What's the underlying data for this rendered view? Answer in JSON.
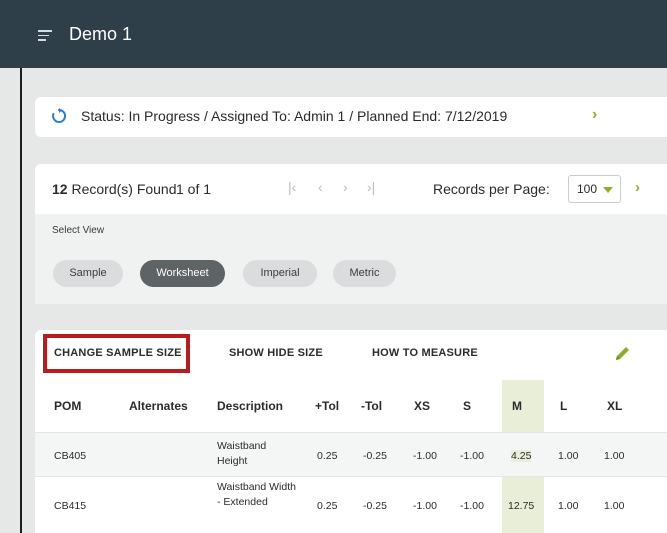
{
  "header": {
    "title": "Demo 1",
    "menu_icon": "menu-icon"
  },
  "status": {
    "icon": "sync-icon",
    "text": "Status: In Progress / Assigned To: Admin 1 / Planned End: 7/12/2019",
    "chevron": "›"
  },
  "pager": {
    "count": "12",
    "found_label": " Record(s) Found",
    "page": "1 of 1",
    "first": "|‹",
    "prev": "‹",
    "next_page": "›",
    "last": "›|",
    "records_per_page_label": "Records per Page:",
    "records_per_page": "100",
    "next": "›"
  },
  "view": {
    "label": "Select View",
    "options": [
      "Sample",
      "Worksheet",
      "Imperial",
      "Metric"
    ],
    "selected": "Worksheet"
  },
  "toolbar": {
    "change_sample_size": "CHANGE SAMPLE SIZE",
    "show_hide_size": "SHOW HIDE SIZE",
    "how_to_measure": "HOW TO MEASURE",
    "edit_icon": "pencil-icon"
  },
  "table": {
    "columns": [
      "POM",
      "Alternates",
      "Description",
      "+Tol",
      "-Tol",
      "XS",
      "S",
      "M",
      "L",
      "XL"
    ],
    "highlighted_column": "M",
    "rows": [
      {
        "pom": "CB405",
        "alternates": "",
        "description": "Waistband Height",
        "plus_tol": "0.25",
        "minus_tol": "-0.25",
        "xs": "-1.00",
        "s": "-1.00",
        "m": "4.25",
        "l": "1.00",
        "xl": "1.00"
      },
      {
        "pom": "CB415",
        "alternates": "",
        "description": "Waistband Width - Extended",
        "plus_tol": "0.25",
        "minus_tol": "-0.25",
        "xs": "-1.00",
        "s": "-1.00",
        "m": "12.75",
        "l": "1.00",
        "xl": "1.00"
      }
    ]
  },
  "colors": {
    "header_bg": "#2f3f4a",
    "accent_green": "#8fae2a",
    "highlight_red": "#b81c1c",
    "m_column_bg": "#e8eed8"
  }
}
